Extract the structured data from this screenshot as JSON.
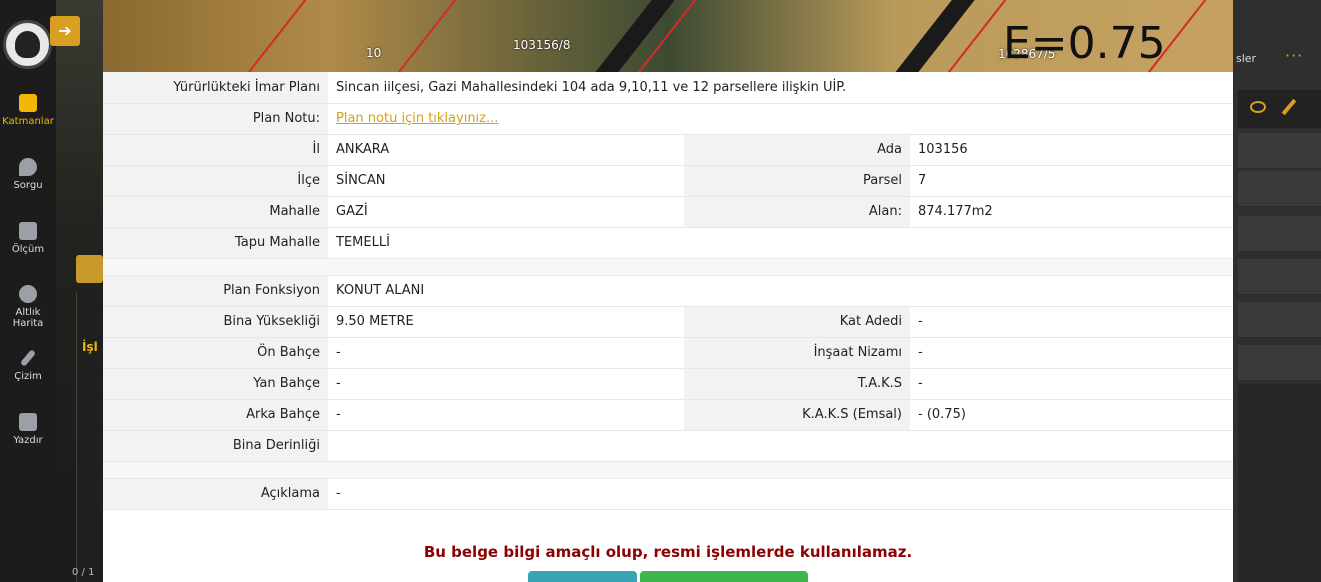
{
  "sidebar": {
    "tools": [
      {
        "label": "Katmanlar",
        "icon": "layers-icon",
        "active": true
      },
      {
        "label": "Sorgu",
        "icon": "location-pin-icon",
        "active": false
      },
      {
        "label": "Ölçüm",
        "icon": "ruler-icon",
        "active": false
      },
      {
        "label": "Altlık Harita",
        "icon": "basemap-icon",
        "active": false
      },
      {
        "label": "Çizim",
        "icon": "pencil-icon",
        "active": false
      },
      {
        "label": "Yazdır",
        "icon": "printer-icon",
        "active": false
      }
    ],
    "expand_icon": "➔"
  },
  "left_panel": {
    "title": "İşl",
    "count": "0 / 1"
  },
  "right_panel": {
    "title": "sler",
    "menu": "···"
  },
  "map": {
    "parcel_label_left": "103156/8",
    "parcel_label_right": "102867/5",
    "edge_number": "10",
    "emsal_text": "E=0.75"
  },
  "info": {
    "imar_plani_label": "Yürürlükteki İmar Planı",
    "imar_plani_value": "Sincan iilçesi, Gazi Mahallesindeki 104 ada 9,10,11 ve 12 parsellere ilişkin UİP.",
    "plan_notu_label": "Plan Notu:",
    "plan_notu_link": "Plan notu için tıklayınız...",
    "il_label": "İl",
    "il_value": "ANKARA",
    "ada_label": "Ada",
    "ada_value": "103156",
    "ilce_label": "İlçe",
    "ilce_value": "SİNCAN",
    "parsel_label": "Parsel",
    "parsel_value": "7",
    "mahalle_label": "Mahalle",
    "mahalle_value": "GAZİ",
    "alan_label": "Alan:",
    "alan_value": "874.177m2",
    "tapu_label": "Tapu Mahalle",
    "tapu_value": "TEMELLİ",
    "fonksiyon_label": "Plan Fonksiyon",
    "fonksiyon_value": "KONUT ALANI",
    "yukseklik_label": "Bina Yüksekliği",
    "yukseklik_value": "9.50 METRE",
    "kat_label": "Kat Adedi",
    "kat_value": "-",
    "on_label": "Ön Bahçe",
    "on_value": "-",
    "nizam_label": "İnşaat Nizamı",
    "nizam_value": "-",
    "yan_label": "Yan Bahçe",
    "yan_value": "-",
    "taks_label": "T.A.K.S",
    "taks_value": "-",
    "arka_label": "Arka Bahçe",
    "arka_value": "-",
    "kaks_label": "K.A.K.S (Emsal)",
    "kaks_value": "- (0.75)",
    "derinlik_label": "Bina Derinliği",
    "derinlik_value": "",
    "aciklama_label": "Açıklama",
    "aciklama_value": "-"
  },
  "warning": "Bu belge bilgi amaçlı olup, resmi işlemlerde kullanılamaz."
}
